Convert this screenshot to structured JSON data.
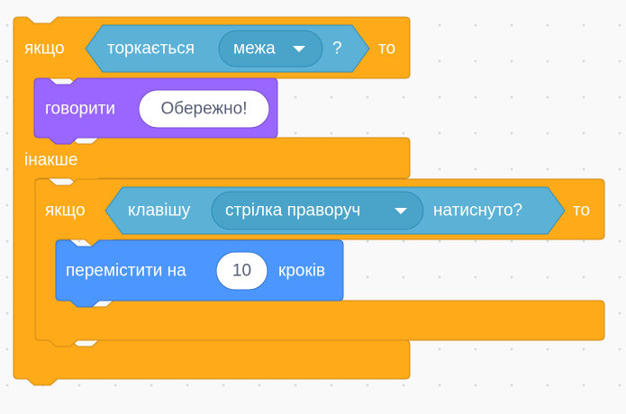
{
  "script": {
    "outer_if": {
      "if_label": "якщо",
      "then_label": "то",
      "else_label": "інакше"
    },
    "touching": {
      "label": "торкається",
      "dropdown_value": "межа",
      "question_mark": "?"
    },
    "say": {
      "label": "говорити",
      "message": "Обережно!"
    },
    "inner_if": {
      "if_label": "якщо",
      "then_label": "то"
    },
    "key_pressed": {
      "label": "клавішу",
      "dropdown_value": "стрілка праворуч",
      "suffix": "натиснуто?"
    },
    "move": {
      "label": "перемістити на",
      "steps": "10",
      "suffix": "кроків"
    }
  },
  "colors": {
    "control": "#ffab19",
    "control_dark": "#cf8b17",
    "sensing": "#5cb1d6",
    "sensing_dark": "#2e8eb8",
    "looks": "#9966ff",
    "looks_dark": "#774dcb",
    "motion": "#4c97ff",
    "motion_dark": "#3373cc"
  }
}
